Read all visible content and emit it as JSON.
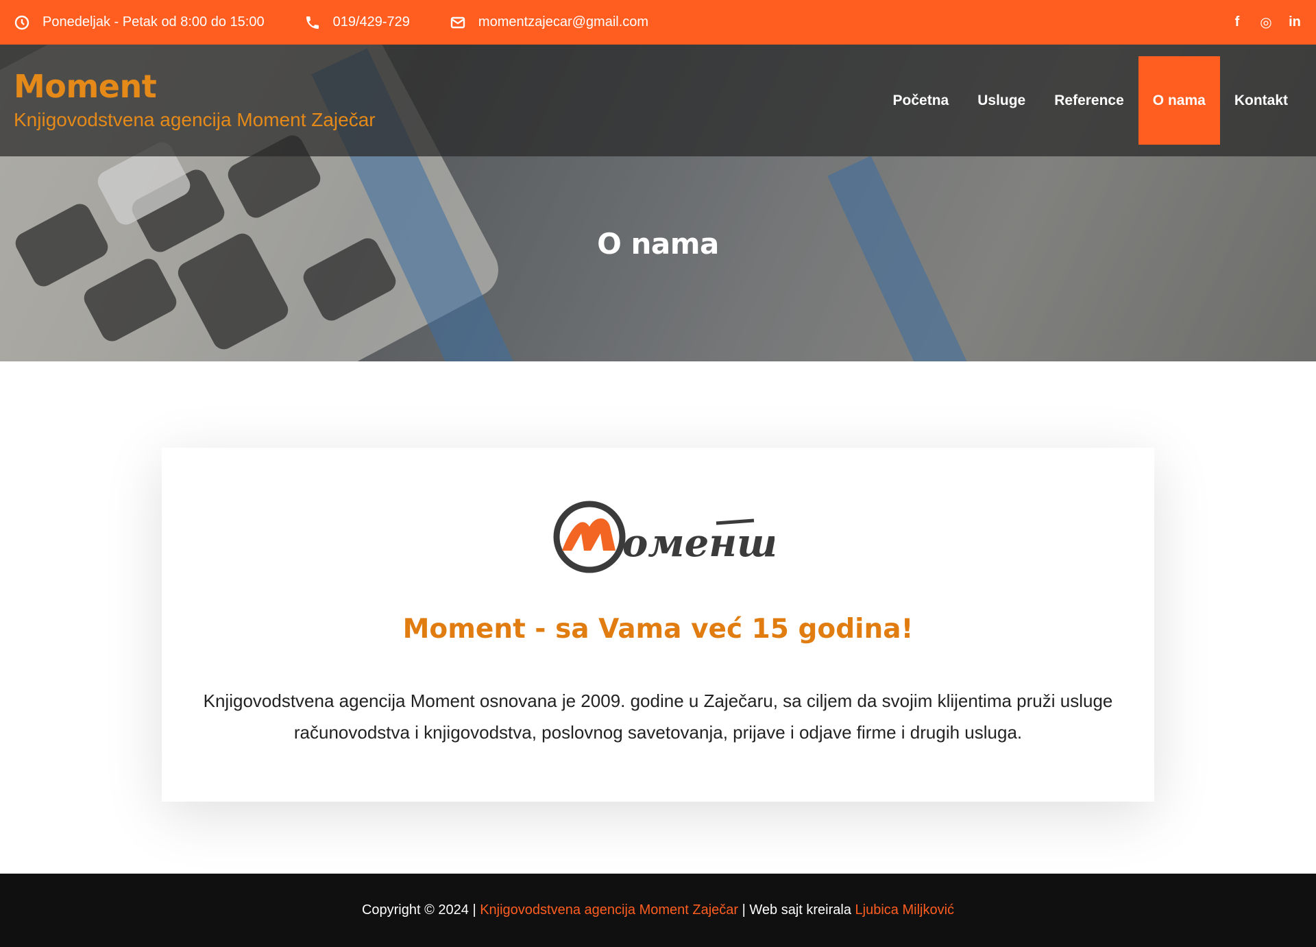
{
  "topbar": {
    "hours": "Ponedeljak - Petak od 8:00 do 15:00",
    "phone": "019/429-729",
    "email": "momentzajecar@gmail.com",
    "social": [
      {
        "name": "facebook-icon",
        "glyph": "f"
      },
      {
        "name": "instagram-icon",
        "glyph": "◎"
      },
      {
        "name": "linkedin-icon",
        "glyph": "in"
      }
    ]
  },
  "brand": {
    "name": "Moment",
    "tagline": "Knjigovodstvena agencija Moment Zaječar",
    "color": "#e58a19"
  },
  "nav": {
    "items": [
      {
        "label": "Početna",
        "active": false
      },
      {
        "label": "Usluge",
        "active": false
      },
      {
        "label": "Reference",
        "active": false
      },
      {
        "label": "O nama",
        "active": true
      },
      {
        "label": "Kontakt",
        "active": false
      }
    ],
    "accent": "#ff5e20"
  },
  "hero": {
    "title": "O nama"
  },
  "about": {
    "logo_text": "Moment",
    "heading": "Moment - sa Vama već 15 godina!",
    "paragraph": "Knjigovodstvena agencija Moment osnovana je 2009. godine u Zaječaru, sa ciljem da svojim klijentima pruži usluge računovodstva i knjigovodstva, poslovnog savetovanja, prijave i odjave firme i drugih usluga."
  },
  "footer": {
    "prefix": "Copyright © 2024 | ",
    "company_link": "Knjigovodstvena agencija Moment Zaječar",
    "middle": " | Web sajt kreirala ",
    "author_link": "Ljubica Miljković"
  }
}
